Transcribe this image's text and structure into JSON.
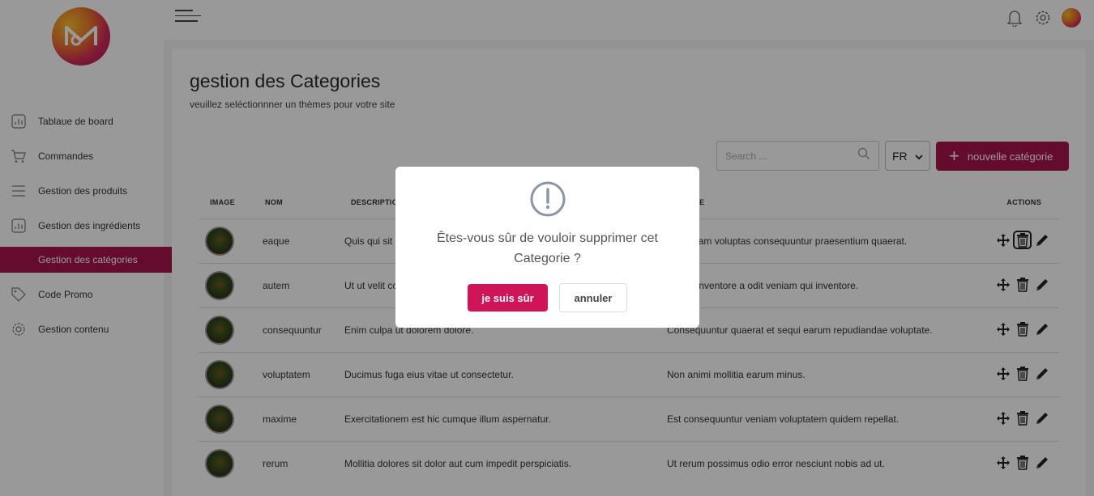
{
  "sidebar": {
    "logo_icon": "brand-logo-icon",
    "items": [
      {
        "label": "Tablaue de board",
        "icon": "chart-icon"
      },
      {
        "label": "Commandes",
        "icon": "cart-icon"
      },
      {
        "label": "Gestion des produits",
        "icon": "list-icon"
      },
      {
        "label": "Gestion des ingrédients",
        "icon": "chart-icon"
      },
      {
        "label": "Gestion des catégories",
        "icon": "category-icon",
        "active": true
      },
      {
        "label": "Code Promo",
        "icon": "tag-icon"
      },
      {
        "label": "Gestion contenu",
        "icon": "gear-icon"
      }
    ]
  },
  "header": {
    "icons": [
      "bell-icon",
      "gear-icon",
      "avatar"
    ]
  },
  "page": {
    "title": "gestion des Categories",
    "subtitle": "veuillez seléctionnner un thèmes pour votre site",
    "search_placeholder": "Search ...",
    "language": "FR",
    "new_button": "nouvelle catégorie"
  },
  "table": {
    "headers": {
      "image": "IMAGE",
      "nom": "NOM",
      "description": "DESCRIPTION",
      "subtitle": "SUBTITLE",
      "actions": "ACTIONS"
    },
    "rows": [
      {
        "nom": "eaque",
        "description": "Quis qui sit quo dolores et.",
        "subtitle": "Non quam voluptas consequuntur praesentium quaerat."
      },
      {
        "nom": "autem",
        "description": "Ut ut velit corporis sint.",
        "subtitle": "Et sint inventore a odit veniam qui inventore."
      },
      {
        "nom": "consequuntur",
        "description": "Enim culpa ut dolorem dolore.",
        "subtitle": "Consequuntur quaerat et sequi earum repudiandae voluptate."
      },
      {
        "nom": "voluptatem",
        "description": "Ducimus fuga eius vitae ut consectetur.",
        "subtitle": "Non animi mollitia earum minus."
      },
      {
        "nom": "maxime",
        "description": "Exercitationem est hic cumque illum aspernatur.",
        "subtitle": "Est consequuntur veniam voluptatem quidem repellat."
      },
      {
        "nom": "rerum",
        "description": "Mollitia dolores sit dolor aut cum impedit perspiciatis.",
        "subtitle": "Ut rerum possimus odio error nesciunt nobis ad ut."
      }
    ]
  },
  "modal": {
    "icon": "warning-icon",
    "message": "Êtes-vous sûr de vouloir supprimer cet Categorie ?",
    "confirm": "je suis sûr",
    "cancel": "annuler"
  },
  "colors": {
    "accent": "#a8134e",
    "confirm": "#d01458"
  }
}
